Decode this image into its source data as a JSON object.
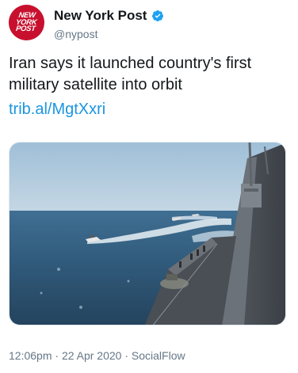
{
  "account": {
    "display_name": "New York Post",
    "handle": "@nypost",
    "avatar_logo_lines": [
      "NEW",
      "YORK",
      "POST"
    ],
    "verified_icon": "verified-badge-icon"
  },
  "tweet": {
    "text": "Iran says it launched country's first military satellite into orbit",
    "link_text": "trib.al/MgtXxri"
  },
  "media": {
    "description_icon": "photo-ship-at-sea"
  },
  "meta": {
    "time": "12:06pm",
    "separator": "·",
    "date": "22 Apr 2020",
    "source": "SocialFlow",
    "full": "12:06pm · 22 Apr 2020 · SocialFlow"
  },
  "colors": {
    "brand_red": "#c8102e",
    "link_blue": "#1b95e0",
    "verified_blue": "#1da1f2",
    "meta_gray": "#657786"
  }
}
